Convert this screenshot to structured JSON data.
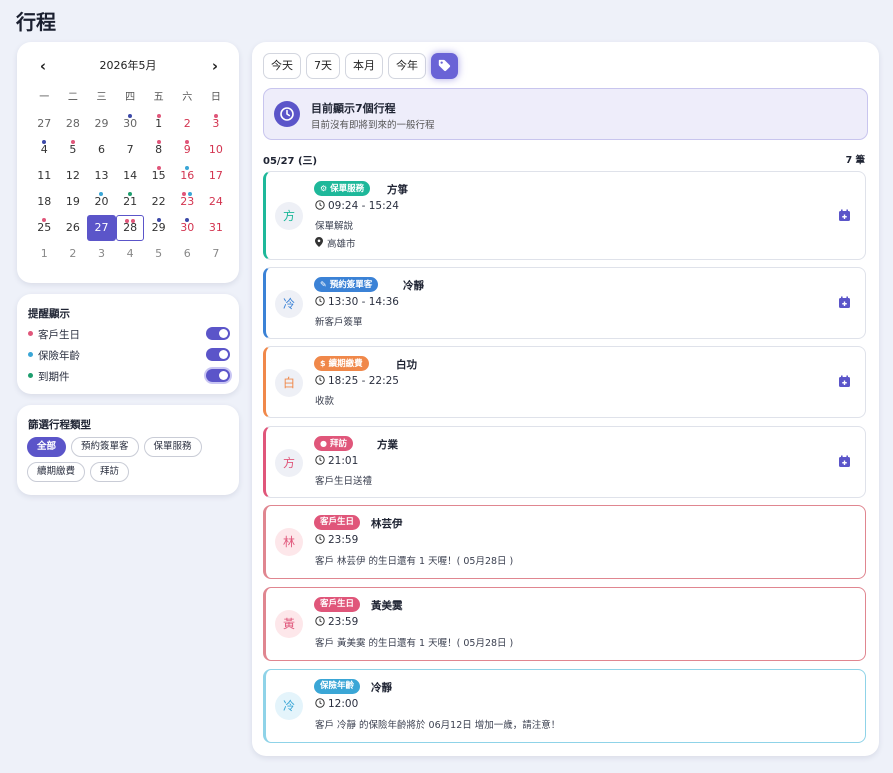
{
  "page_title": "行程",
  "calendar": {
    "title": "2026年5月",
    "weekdays": [
      "一",
      "二",
      "三",
      "四",
      "五",
      "六",
      "日"
    ],
    "weeks": [
      [
        "27",
        "28",
        "29",
        "30",
        "1",
        "2",
        "3"
      ],
      [
        "4",
        "5",
        "6",
        "7",
        "8",
        "9",
        "10"
      ],
      [
        "11",
        "12",
        "13",
        "14",
        "15",
        "16",
        "17"
      ],
      [
        "18",
        "19",
        "20",
        "21",
        "22",
        "23",
        "24"
      ],
      [
        "25",
        "26",
        "27",
        "28",
        "29",
        "30",
        "31"
      ],
      [
        "1",
        "2",
        "3",
        "4",
        "5",
        "6",
        "7"
      ]
    ],
    "selected_day": "27",
    "today_day": "28"
  },
  "reminders": {
    "title": "提醒顯示",
    "items": [
      {
        "label": "客戶生日",
        "color": "#e0567a",
        "on": true
      },
      {
        "label": "保險年齡",
        "color": "#3aa6d6",
        "on": true
      },
      {
        "label": "到期件",
        "color": "#1e9e6e",
        "on": true
      }
    ]
  },
  "filter": {
    "title": "篩選行程類型",
    "chips": [
      "全部",
      "預約簽單客",
      "保單服務",
      "續期繳費",
      "拜訪"
    ],
    "active": "全部"
  },
  "range_buttons": [
    "今天",
    "7天",
    "本月",
    "今年"
  ],
  "banner": {
    "title": "目前顯示7個行程",
    "subtitle": "目前沒有即將到來的一般行程"
  },
  "date_header": "05/27 (三)",
  "count_label": "7 筆",
  "colors": {
    "accent": "#5b55c9",
    "birthday": "#e0567a",
    "age": "#3aa6d6",
    "service": "#1eb89a",
    "signing": "#3b82d6",
    "payment": "#f0884a",
    "visit": "#e0567a"
  },
  "events": [
    {
      "avatar": "方",
      "badge": "保單服務",
      "badge_icon": "gears-icon",
      "name": "方箏",
      "time": "09:24 - 15:24",
      "note": "保單解說",
      "location": "高雄市"
    },
    {
      "avatar": "冷",
      "badge": "預約簽單客",
      "badge_icon": "pen-icon",
      "name": "冷靜",
      "time": "13:30 - 14:36",
      "note": "新客戶簽單"
    },
    {
      "avatar": "白",
      "badge": "續期繳費",
      "badge_icon": "money-bag-icon",
      "name": "白功",
      "time": "18:25 - 22:25",
      "note": "收款"
    },
    {
      "avatar": "方",
      "badge": "拜訪",
      "badge_icon": "user-icon",
      "name": "方業",
      "time": "21:01",
      "note": "客戶生日送禮"
    },
    {
      "avatar": "林",
      "badge": "客戶生日",
      "name": "林芸伊",
      "time": "23:59",
      "note": "客戶 林芸伊 的生日還有 1 天喔！( 05月28日 )"
    },
    {
      "avatar": "黃",
      "badge": "客戶生日",
      "name": "黃美霙",
      "time": "23:59",
      "note": "客戶 黃美霙 的生日還有 1 天喔！( 05月28日 )"
    },
    {
      "avatar": "冷",
      "badge": "保險年齡",
      "name": "冷靜",
      "time": "12:00",
      "note": "客戶 冷靜 的保險年齡將於 06月12日 增加一歲，請注意！"
    }
  ]
}
